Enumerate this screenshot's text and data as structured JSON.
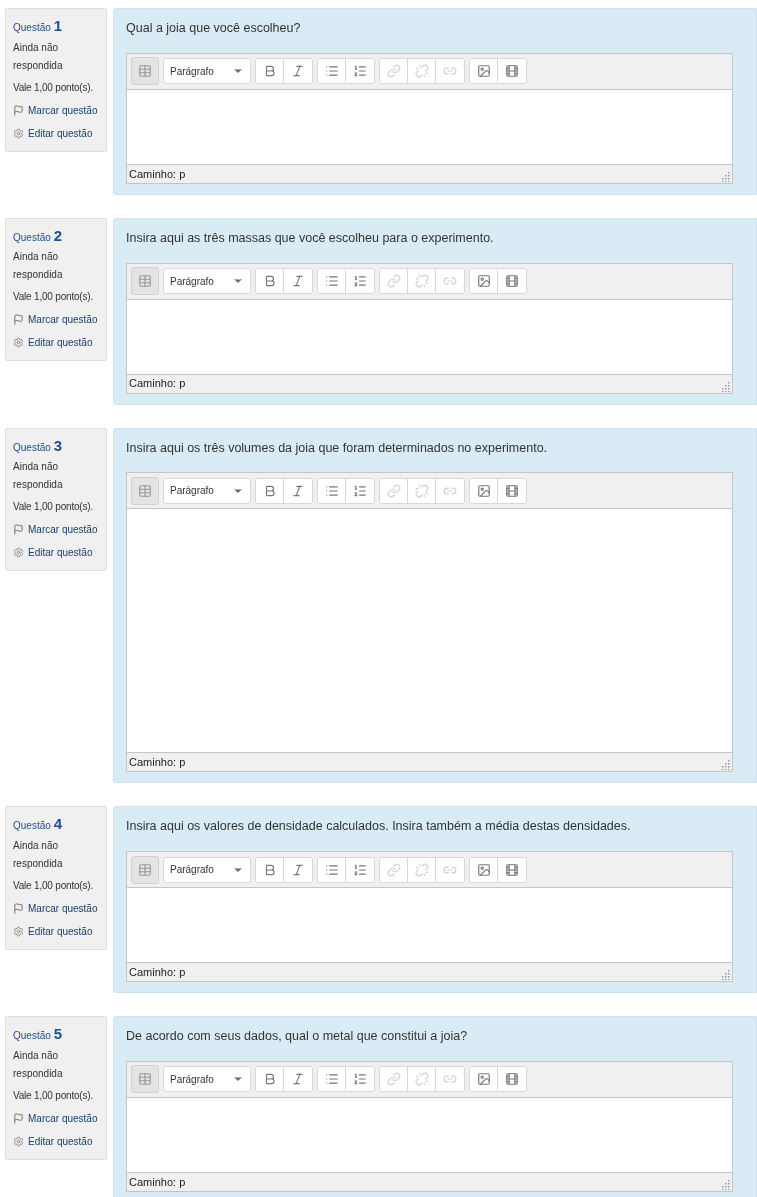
{
  "toolbar_groups": [
    [
      {
        "kind": "bold",
        "disabled": false
      },
      {
        "kind": "italic",
        "disabled": false
      }
    ],
    [
      {
        "kind": "bullet-list",
        "disabled": false
      },
      {
        "kind": "numbered-list",
        "disabled": false
      }
    ],
    [
      {
        "kind": "link",
        "disabled": true
      },
      {
        "kind": "unlink",
        "disabled": true
      },
      {
        "kind": "anchor",
        "disabled": true
      }
    ],
    [
      {
        "kind": "image",
        "disabled": false
      },
      {
        "kind": "media",
        "disabled": false
      }
    ]
  ],
  "questions": [
    {
      "label": "Questão",
      "number": "1",
      "status": "Ainda não respondida",
      "points": "Vale 1,00 ponto(s).",
      "flag_link": "Marcar questão",
      "edit_link": "Editar questão",
      "text": "Qual a joia que você escolheu?",
      "editor": {
        "format": "Parágrafo",
        "path": "Caminho: p",
        "tall": false
      }
    },
    {
      "label": "Questão",
      "number": "2",
      "status": "Ainda não respondida",
      "points": "Vale 1,00 ponto(s).",
      "flag_link": "Marcar questão",
      "edit_link": "Editar questão",
      "text": "Insira aqui as três massas que você escolheu para o experimento.",
      "editor": {
        "format": "Parágrafo",
        "path": "Caminho: p",
        "tall": false
      }
    },
    {
      "label": "Questão",
      "number": "3",
      "status": "Ainda não respondida",
      "points": "Vale 1,00 ponto(s).",
      "flag_link": "Marcar questão",
      "edit_link": "Editar questão",
      "text": "Insira aqui os três volumes da joia que foram determinados no experimento.",
      "editor": {
        "format": "Parágrafo",
        "path": "Caminho: p",
        "tall": true
      }
    },
    {
      "label": "Questão",
      "number": "4",
      "status": "Ainda não respondida",
      "points": "Vale 1,00 ponto(s).",
      "flag_link": "Marcar questão",
      "edit_link": "Editar questão",
      "text": "Insira aqui os valores de densidade calculados. Insira também a média destas densidades.",
      "editor": {
        "format": "Parágrafo",
        "path": "Caminho: p",
        "tall": false
      }
    },
    {
      "label": "Questão",
      "number": "5",
      "status": "Ainda não respondida",
      "points": "Vale 1,00 ponto(s).",
      "flag_link": "Marcar questão",
      "edit_link": "Editar questão",
      "text": "De acordo com seus dados, qual o metal que constitui a joia?",
      "editor": {
        "format": "Parágrafo",
        "path": "Caminho: p",
        "tall": false
      }
    }
  ]
}
